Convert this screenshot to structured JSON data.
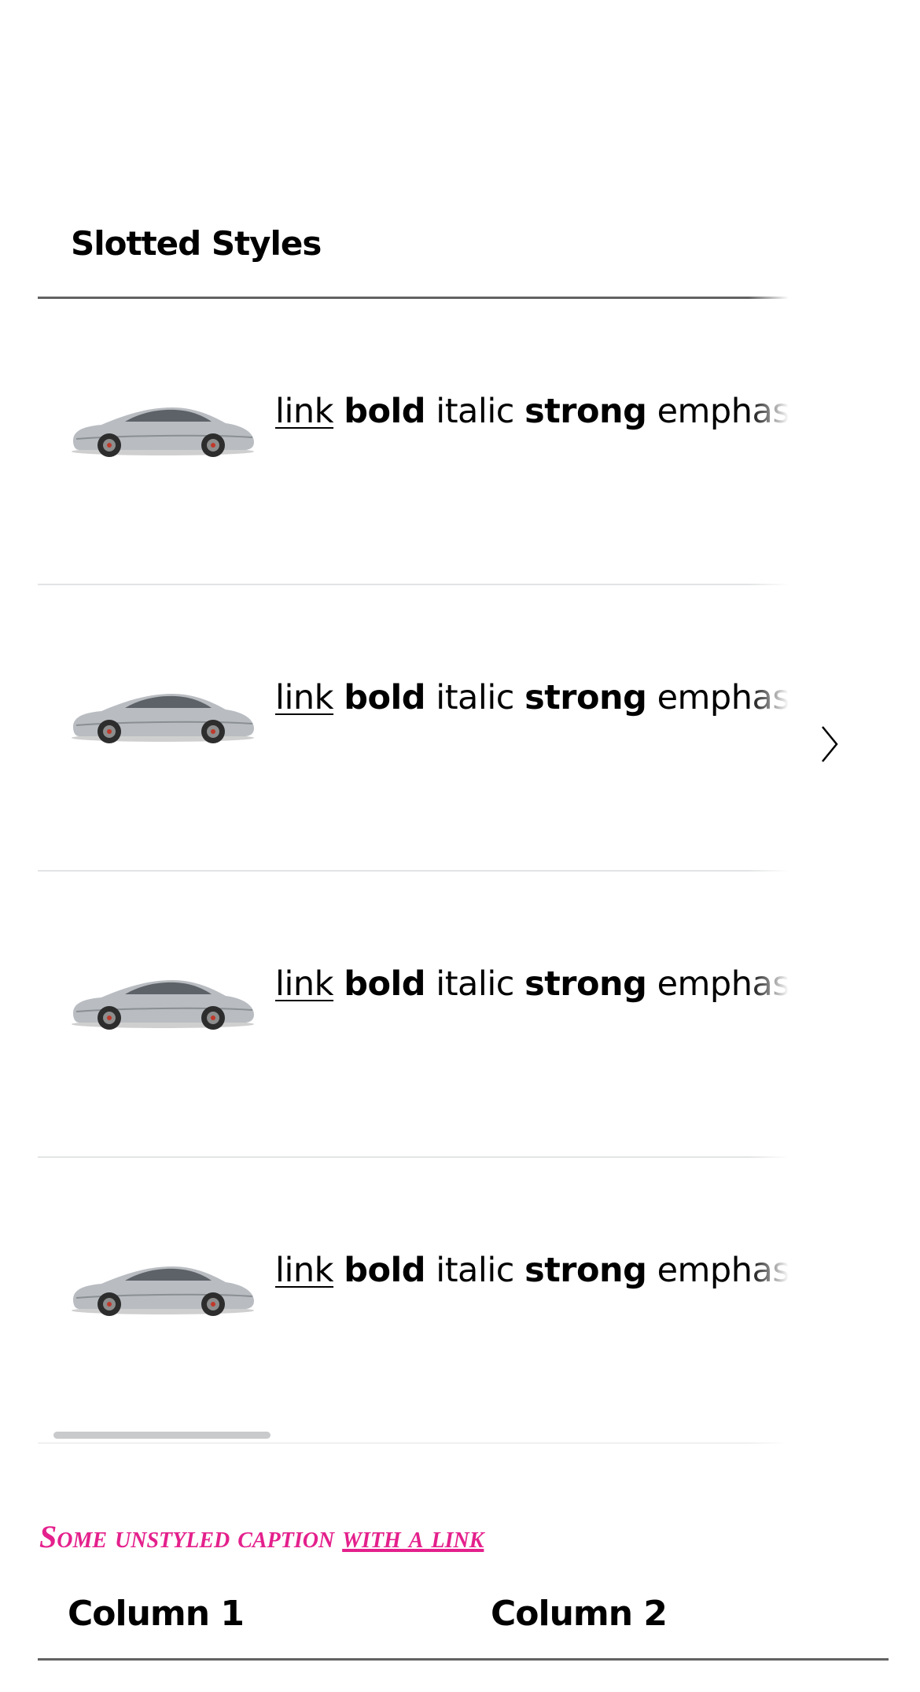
{
  "table": {
    "header": "Slotted Styles",
    "rows": [
      {
        "image_alt": "car",
        "link": "link",
        "bold": "bold",
        "italic": "italic",
        "strong": "strong",
        "emphasized": "emphasized"
      },
      {
        "image_alt": "car",
        "link": "link",
        "bold": "bold",
        "italic": "italic",
        "strong": "strong",
        "emphasized": "emphasized"
      },
      {
        "image_alt": "car",
        "link": "link",
        "bold": "bold",
        "italic": "italic",
        "strong": "strong",
        "emphasized": "emphasized"
      },
      {
        "image_alt": "car",
        "link": "link",
        "bold": "bold",
        "italic": "italic",
        "strong": "strong",
        "emphasized": "emphasized"
      }
    ],
    "scroll_icon": "chevron-right-icon"
  },
  "second_table": {
    "caption_text": "Some unstyled caption ",
    "caption_link": "with a link",
    "columns": [
      "Column 1",
      "Column 2"
    ]
  },
  "colors": {
    "caption": "#e4208c",
    "header_border": "#626262",
    "row_border": "#e3e4e5",
    "scrollbar": "#c9cacb"
  }
}
